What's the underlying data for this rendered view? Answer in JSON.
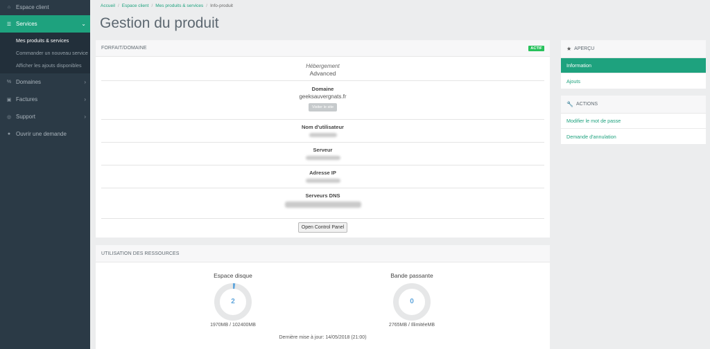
{
  "sidebar": {
    "items": [
      {
        "label": "Espace client",
        "icon": "home-icon"
      },
      {
        "label": "Services",
        "icon": "services-icon",
        "active": true,
        "subitems": [
          "Mes produits & services",
          "Commander un nouveau service",
          "Afficher les ajouts disponibles"
        ]
      },
      {
        "label": "Domaines",
        "icon": "domains-icon"
      },
      {
        "label": "Factures",
        "icon": "invoice-icon"
      },
      {
        "label": "Support",
        "icon": "support-icon"
      },
      {
        "label": "Ouvrir une demande",
        "icon": "chat-icon"
      }
    ]
  },
  "breadcrumb": [
    "Accueil",
    "Espace client",
    "Mes produits & services",
    "Info-produit"
  ],
  "page_title": "Gestion du produit",
  "product": {
    "header": "FORFAIT/DOMAINE",
    "status_badge": "ACTIF",
    "hosting_label": "Hébergement",
    "hosting_value": "Advanced",
    "domain_label": "Domaine",
    "domain_value": "geeksauvergnats.fr",
    "visit_button": "Visiter le site",
    "username_label": "Nom d'utilisateur",
    "server_label": "Serveur",
    "ip_label": "Adresse IP",
    "dns_label": "Serveurs DNS",
    "control_panel_button": "Open Control Panel"
  },
  "resources": {
    "header": "UTILISATION DES RESSOURCES",
    "disk": {
      "title": "Espace disque",
      "value": "2",
      "caption": "1970MB / 102400MB",
      "percent": 1.92
    },
    "bandwidth": {
      "title": "Bande passante",
      "value": "0",
      "caption": "2765MB / IllimitéeMB",
      "percent": 0
    },
    "updated": "Dernière mise à jour: 14/05/2018 (21:00)"
  },
  "overview": {
    "header": "APERÇU",
    "items": [
      "Information",
      "Ajouts"
    ]
  },
  "actions": {
    "header": "ACTIONS",
    "items": [
      "Modifier le mot de passe",
      "Demande d'annulation"
    ]
  },
  "colors": {
    "accent": "#1ea27e",
    "sidebar": "#2b3a46",
    "badge": "#27c15b",
    "gauge": "#60a6dc"
  }
}
